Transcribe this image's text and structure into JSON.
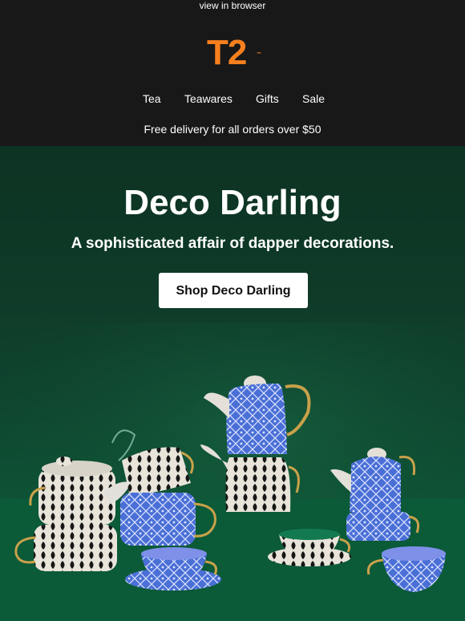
{
  "header": {
    "view_in_browser": "view in browser",
    "logo": "T2",
    "logo_tm": "™",
    "nav": [
      "Tea",
      "Teawares",
      "Gifts",
      "Sale"
    ],
    "delivery": "Free delivery for all orders over $50"
  },
  "hero": {
    "title": "Deco Darling",
    "subtitle": "A sophisticated affair of dapper decorations.",
    "cta_label": "Shop Deco Darling"
  },
  "colors": {
    "brand_orange": "#f7801e",
    "header_bg": "#181818",
    "hero_green": "#0f4630",
    "teaware_blue": "#4a6fd6",
    "gold": "#c9a14a"
  }
}
